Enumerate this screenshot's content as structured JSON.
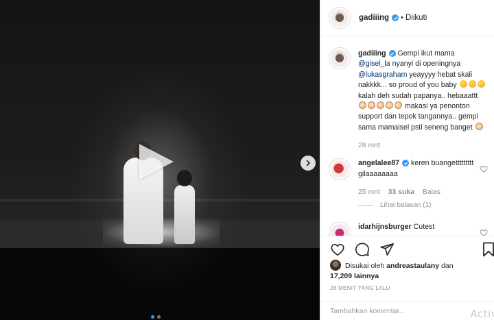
{
  "media": {
    "type": "video",
    "carousel_dots": 2,
    "active_dot": 1
  },
  "post_header": {
    "username": "gadiiing",
    "separator": "•",
    "follow_state": "Diikuti"
  },
  "caption": {
    "username": "gadiiing",
    "part1": " Gempi ikut mama ",
    "mention1": "@gisel_la",
    "part2": " nyanyi di openingnya ",
    "mention2": "@lukasgraham",
    "part3": " yeayyyy hebat skali nakkkk... so proud of you baby ",
    "part4": " kalah deh sudah papanya.. hebaaattt ",
    "part5": " makasi ya penonton support dan tepok tangannya.. gempi sama mamaisel psti seneng banget ",
    "time": "28 mnt"
  },
  "comments": [
    {
      "username": "angelalee87",
      "text": " keren buangettttttttt gilaaaaaaaa",
      "time": "25 mnt",
      "likes": "33 suka",
      "reply_label": "Balas",
      "view_replies": "Lihat balasan (1)"
    },
    {
      "username": "idarhijnsburger",
      "text": " Cutest"
    }
  ],
  "actions": {
    "liked_prefix": "Disukai oleh ",
    "liked_user": "andreastaulany",
    "liked_mid": " dan",
    "liked_count": "17,209 lainnya",
    "timestamp": "28 MENIT YANG LALU",
    "comment_placeholder": "Tambahkan komentar...",
    "watermark": "Activ"
  },
  "colors": {
    "verified": "#3897f0",
    "mention": "#003569",
    "secondary_text": "#8e8e8e"
  }
}
